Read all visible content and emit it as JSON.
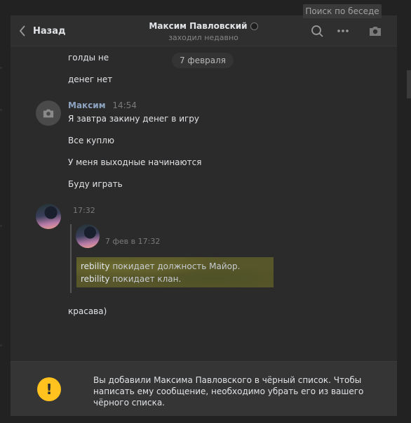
{
  "tooltip": "Поиск по беседе",
  "header": {
    "back_label": "Назад",
    "title": "Максим Павловский",
    "status": "заходил недавно",
    "icons": [
      "search-icon",
      "more-icon",
      "camera-icon"
    ]
  },
  "date_chip": "7 февраля",
  "messages": {
    "top": [
      "голды не",
      "денег нет"
    ],
    "maxim": {
      "name": "Максим",
      "time": "14:54",
      "lines": [
        "Я завтра закину денег в игру",
        "Все куплю",
        "У меня выходные начинаются",
        "Буду играть"
      ]
    },
    "second": {
      "time": "17:32",
      "forward_time": "7 фев в 17:32",
      "game_lines": [
        {
          "name": "rebility",
          "text": "покидает должность Майор."
        },
        {
          "name": "rebility",
          "text": "покидает клан."
        }
      ],
      "text": "красава)"
    }
  },
  "notice": {
    "icon": "!",
    "text": "Вы добавили Максима Павловского в чёрный список. Чтобы написать ему сообщение, необходимо убрать его из вашего чёрного списка."
  },
  "colors": {
    "accent": "#ffc21f",
    "name": "#8da4c0",
    "background": "#2b2b2b"
  }
}
